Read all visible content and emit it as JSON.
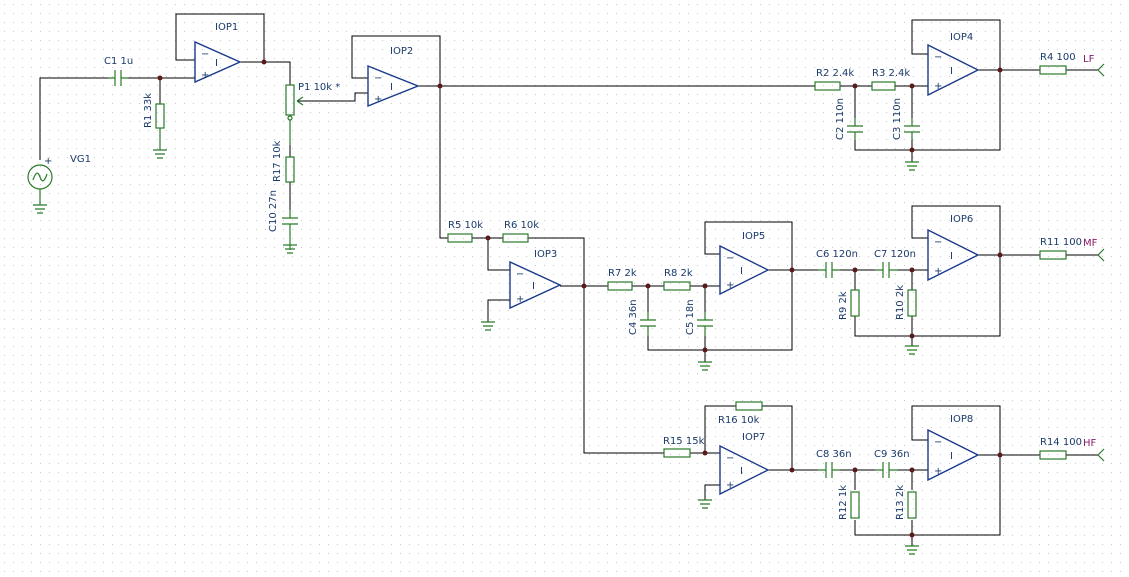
{
  "colors": {
    "wire": "#000000",
    "component": "#2a7a2a",
    "opamp": "#1a3a8a",
    "label": "#1a3a6a",
    "output_label": "#8a1a6a",
    "grid": "#c8c8c8"
  },
  "labels": {
    "vg1": "VG1",
    "c1": "C1 1u",
    "r1": "R1 33k",
    "p1": "P1 10k *",
    "r17": "R17 10k",
    "c10": "C10 27n",
    "r5": "R5 10k",
    "r6": "R6 10k",
    "r7": "R7 2k",
    "r8": "R8 2k",
    "c4": "C4 36n",
    "c5": "C5 18n",
    "c6": "C6 120n",
    "c7": "C7 120n",
    "r9": "R9 2k",
    "r10": "R10 2k",
    "r2": "R2 2.4k",
    "r3": "R3 2.4k",
    "c2": "C2 110n",
    "c3": "C3 110n",
    "r15": "R15 15k",
    "r16": "R16 10k",
    "c8": "C8 36n",
    "c9": "C9 36n",
    "r12": "R12 1k",
    "r13": "R13 2k",
    "r4": "R4 100",
    "r11": "R11 100",
    "r14": "R14 100",
    "lf": "LF",
    "mf": "MF",
    "hf": "HF"
  },
  "opamps": [
    {
      "name": "IOP1"
    },
    {
      "name": "IOP2"
    },
    {
      "name": "IOP3"
    },
    {
      "name": "IOP4"
    },
    {
      "name": "IOP5"
    },
    {
      "name": "IOP6"
    },
    {
      "name": "IOP7"
    },
    {
      "name": "IOP8"
    }
  ],
  "opamp_symbol": {
    "body": "I",
    "minus": "−",
    "plus": "+"
  }
}
